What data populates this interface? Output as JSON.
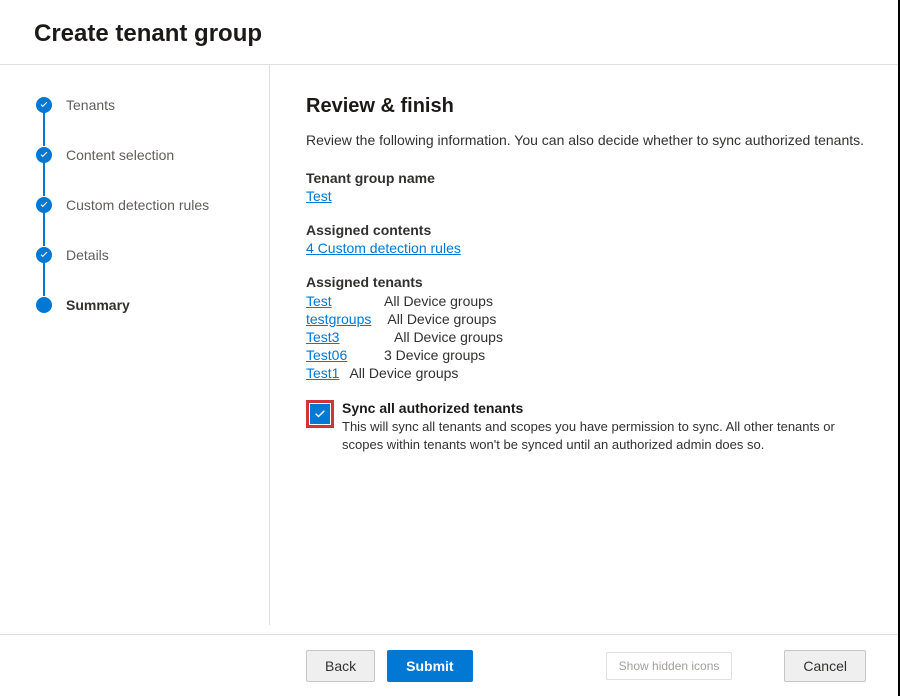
{
  "header": {
    "title": "Create tenant group"
  },
  "steps": [
    {
      "label": "Tenants",
      "state": "done"
    },
    {
      "label": "Content selection",
      "state": "done"
    },
    {
      "label": "Custom detection rules",
      "state": "done"
    },
    {
      "label": "Details",
      "state": "done"
    },
    {
      "label": "Summary",
      "state": "current"
    }
  ],
  "review": {
    "heading": "Review & finish",
    "description": "Review the following information. You can also decide whether to sync authorized tenants.",
    "tenant_group_name_label": "Tenant group name",
    "tenant_group_name_value": "Test",
    "assigned_contents_label": "Assigned contents",
    "assigned_contents_value": "4 Custom detection rules",
    "assigned_tenants_label": "Assigned tenants",
    "tenants": [
      {
        "name": "Test",
        "scope": "All Device groups"
      },
      {
        "name": "testgroups",
        "scope": "All Device groups"
      },
      {
        "name": "Test3",
        "scope": "All Device groups"
      },
      {
        "name": "Test06",
        "scope": "3 Device groups"
      },
      {
        "name": "Test1",
        "scope": "All Device groups"
      }
    ],
    "sync_checkbox_checked": true,
    "sync_title": "Sync all authorized tenants",
    "sync_description": "This will sync all tenants and scopes you have permission to sync. All other tenants or scopes within tenants won't be synced until an authorized admin does so."
  },
  "footer": {
    "back": "Back",
    "submit": "Submit",
    "cancel": "Cancel",
    "hidden_icons": "Show hidden icons"
  }
}
